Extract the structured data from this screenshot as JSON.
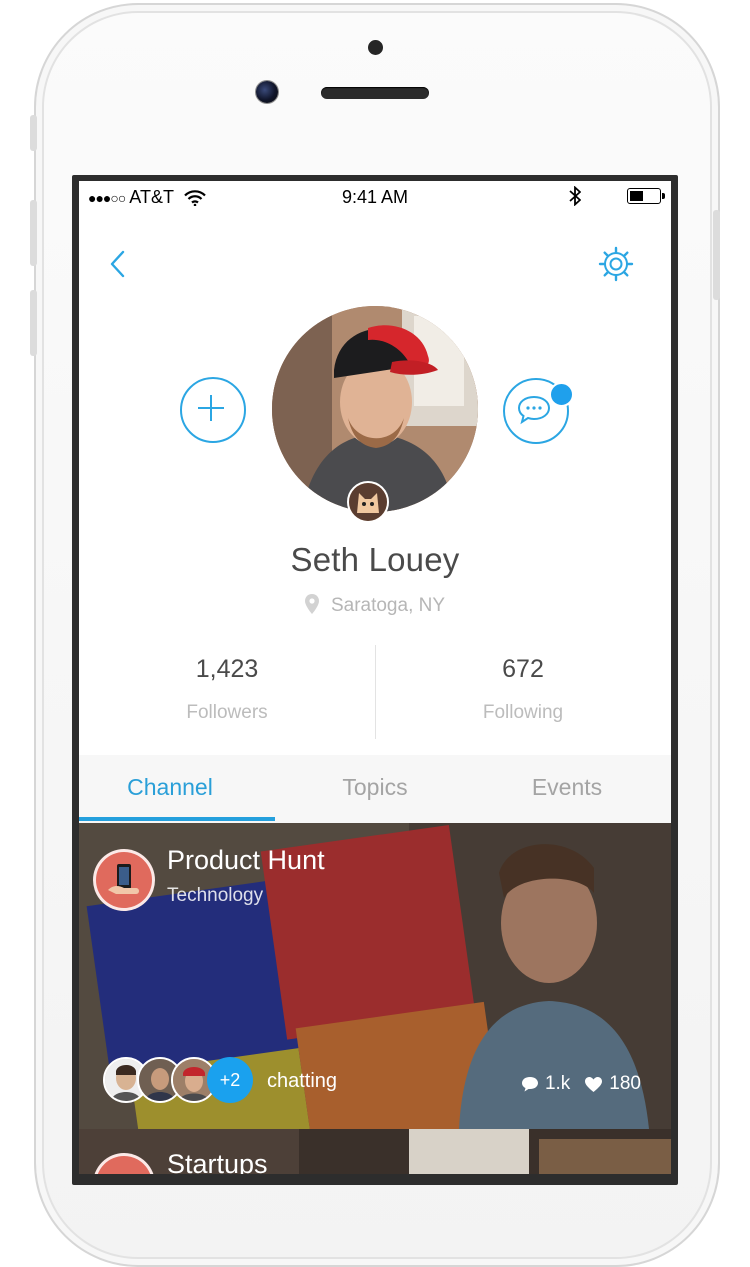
{
  "status_bar": {
    "signal": "●●●○○",
    "carrier": "AT&T",
    "time": "9:41 AM",
    "bluetooth_icon": "bluetooth-icon",
    "battery_icon": "battery-icon"
  },
  "nav": {
    "back_icon": "chevron-left-icon",
    "settings_icon": "gear-icon"
  },
  "profile": {
    "name": "Seth Louey",
    "location": "Saratoga, NY",
    "followers_count": "1,423",
    "followers_label": "Followers",
    "following_count": "672",
    "following_label": "Following"
  },
  "tabs": [
    {
      "label": "Channel",
      "active": true
    },
    {
      "label": "Topics",
      "active": false
    },
    {
      "label": "Events",
      "active": false
    }
  ],
  "channels": [
    {
      "title": "Product Hunt",
      "subtitle": "Technology",
      "extra_chatters": "+2",
      "chatting_label": "chatting",
      "comments": "1.k",
      "likes": "180"
    },
    {
      "title": "Startups"
    }
  ],
  "colors": {
    "accent": "#2a9fd8",
    "notification": "#1fa0ec",
    "channel_icon": "#e06a5d"
  }
}
